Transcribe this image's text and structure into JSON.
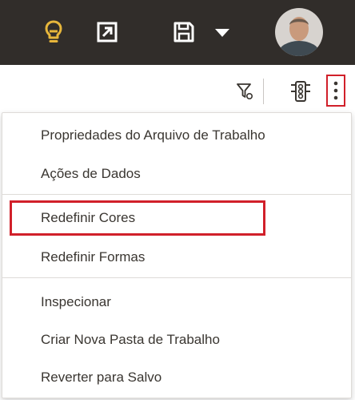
{
  "menu": {
    "items": [
      {
        "label": "Propriedades do Arquivo de Trabalho"
      },
      {
        "label": "Ações de Dados"
      },
      {
        "label": "Redefinir Cores"
      },
      {
        "label": "Redefinir Formas"
      },
      {
        "label": "Inspecionar"
      },
      {
        "label": "Criar Nova Pasta de Trabalho"
      },
      {
        "label": "Reverter para Salvo"
      }
    ]
  },
  "icons": {
    "lightbulb": "lightbulb-icon",
    "expand": "expand-icon",
    "save": "save-icon",
    "dropdown": "chevron-down-icon",
    "avatar": "user-avatar",
    "filter": "filter-icon",
    "traffic": "traffic-light-icon",
    "more": "more-vertical-icon"
  },
  "colors": {
    "topbar": "#312d2a",
    "accent_yellow": "#e7b63b",
    "highlight_red": "#d1202a",
    "text": "#3a3631"
  }
}
